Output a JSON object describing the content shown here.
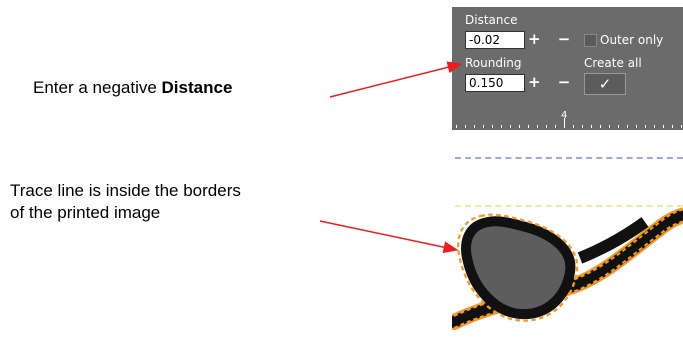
{
  "callouts": {
    "distance_prefix": "Enter a negative ",
    "distance_bold": "Distance",
    "trace_line1": "Trace line is inside the borders",
    "trace_line2": "of the printed image"
  },
  "panel": {
    "distance_label": "Distance",
    "distance_value": "-0.02",
    "rounding_label": "Rounding",
    "rounding_value": "0.150",
    "plus_minus": "+ −",
    "outer_only_label": "Outer only",
    "create_all_label": "Create all",
    "apply_symbol": "✓",
    "ruler_number": "4"
  },
  "colors": {
    "arrow": "#ee1c1c",
    "panel_bg": "#6b6b6b",
    "trace_orange": "#f29b2a",
    "shape_fill": "#5d5d5d"
  }
}
